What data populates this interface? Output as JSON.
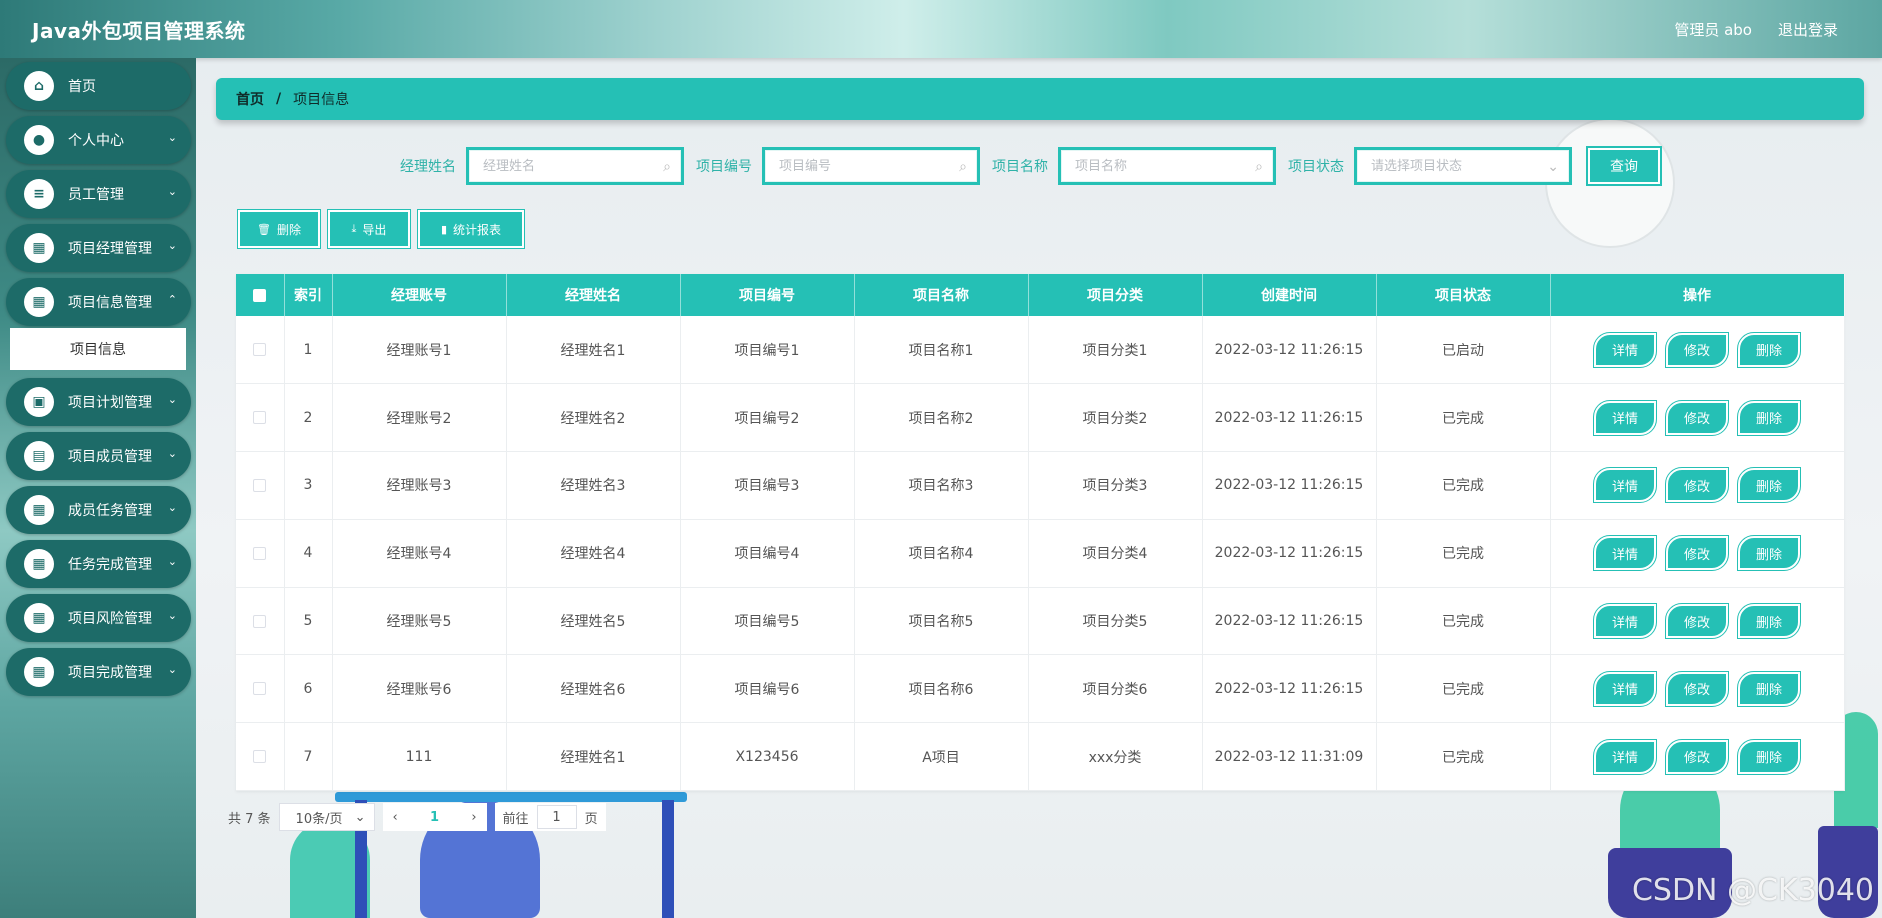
{
  "header": {
    "title": "Java外包项目管理系统",
    "user": "管理员 abo",
    "logout": "退出登录"
  },
  "sidebar": {
    "items": [
      {
        "label": "首页",
        "icon": "home-icon",
        "glyph": "⌂"
      },
      {
        "label": "个人中心",
        "icon": "user-icon",
        "glyph": "●"
      },
      {
        "label": "员工管理",
        "icon": "list-icon",
        "glyph": "≡"
      },
      {
        "label": "项目经理管理",
        "icon": "grid-icon",
        "glyph": "▦"
      },
      {
        "label": "项目信息管理",
        "icon": "grid-icon",
        "glyph": "▦"
      },
      {
        "label": "项目计划管理",
        "icon": "chat-icon",
        "glyph": "▣"
      },
      {
        "label": "项目成员管理",
        "icon": "briefcase-icon",
        "glyph": "▤"
      },
      {
        "label": "成员任务管理",
        "icon": "grid-icon",
        "glyph": "▦"
      },
      {
        "label": "任务完成管理",
        "icon": "grid-icon",
        "glyph": "▦"
      },
      {
        "label": "项目风险管理",
        "icon": "grid-icon",
        "glyph": "▦"
      },
      {
        "label": "项目完成管理",
        "icon": "grid-icon",
        "glyph": "▦"
      }
    ],
    "submenu_label": "项目信息"
  },
  "breadcrumb": {
    "home": "首页",
    "separator": "/",
    "current": "项目信息"
  },
  "filters": {
    "manager_name_label": "经理姓名",
    "manager_name_placeholder": "经理姓名",
    "project_code_label": "项目编号",
    "project_code_placeholder": "项目编号",
    "project_name_label": "项目名称",
    "project_name_placeholder": "项目名称",
    "project_status_label": "项目状态",
    "project_status_placeholder": "请选择项目状态",
    "search_label": "查询"
  },
  "actions": {
    "delete": "删除",
    "export": "导出",
    "report": "统计报表"
  },
  "table": {
    "columns": [
      "索引",
      "经理账号",
      "经理姓名",
      "项目编号",
      "项目名称",
      "项目分类",
      "创建时间",
      "项目状态",
      "操作"
    ],
    "rows": [
      {
        "index": "1",
        "account": "经理账号1",
        "name": "经理姓名1",
        "code": "项目编号1",
        "project": "项目名称1",
        "category": "项目分类1",
        "created": "2022-03-12 11:26:15",
        "status": "已启动"
      },
      {
        "index": "2",
        "account": "经理账号2",
        "name": "经理姓名2",
        "code": "项目编号2",
        "project": "项目名称2",
        "category": "项目分类2",
        "created": "2022-03-12 11:26:15",
        "status": "已完成"
      },
      {
        "index": "3",
        "account": "经理账号3",
        "name": "经理姓名3",
        "code": "项目编号3",
        "project": "项目名称3",
        "category": "项目分类3",
        "created": "2022-03-12 11:26:15",
        "status": "已完成"
      },
      {
        "index": "4",
        "account": "经理账号4",
        "name": "经理姓名4",
        "code": "项目编号4",
        "project": "项目名称4",
        "category": "项目分类4",
        "created": "2022-03-12 11:26:15",
        "status": "已完成"
      },
      {
        "index": "5",
        "account": "经理账号5",
        "name": "经理姓名5",
        "code": "项目编号5",
        "project": "项目名称5",
        "category": "项目分类5",
        "created": "2022-03-12 11:26:15",
        "status": "已完成"
      },
      {
        "index": "6",
        "account": "经理账号6",
        "name": "经理姓名6",
        "code": "项目编号6",
        "project": "项目名称6",
        "category": "项目分类6",
        "created": "2022-03-12 11:26:15",
        "status": "已完成"
      },
      {
        "index": "7",
        "account": "111",
        "name": "经理姓名1",
        "code": "X123456",
        "project": "A项目",
        "category": "xxx分类",
        "created": "2022-03-12 11:31:09",
        "status": "已完成"
      }
    ],
    "row_actions": {
      "detail": "详情",
      "edit": "修改",
      "delete": "删除"
    }
  },
  "pagination": {
    "total": "共 7 条",
    "page_size": "10条/页",
    "current_page": "1",
    "goto_label": "前往",
    "goto_value": "1",
    "page_suffix": "页"
  },
  "watermark": "CSDN @CK3040",
  "colors": {
    "accent": "#25c0b5",
    "sidebar_item": "#1d6b68"
  }
}
